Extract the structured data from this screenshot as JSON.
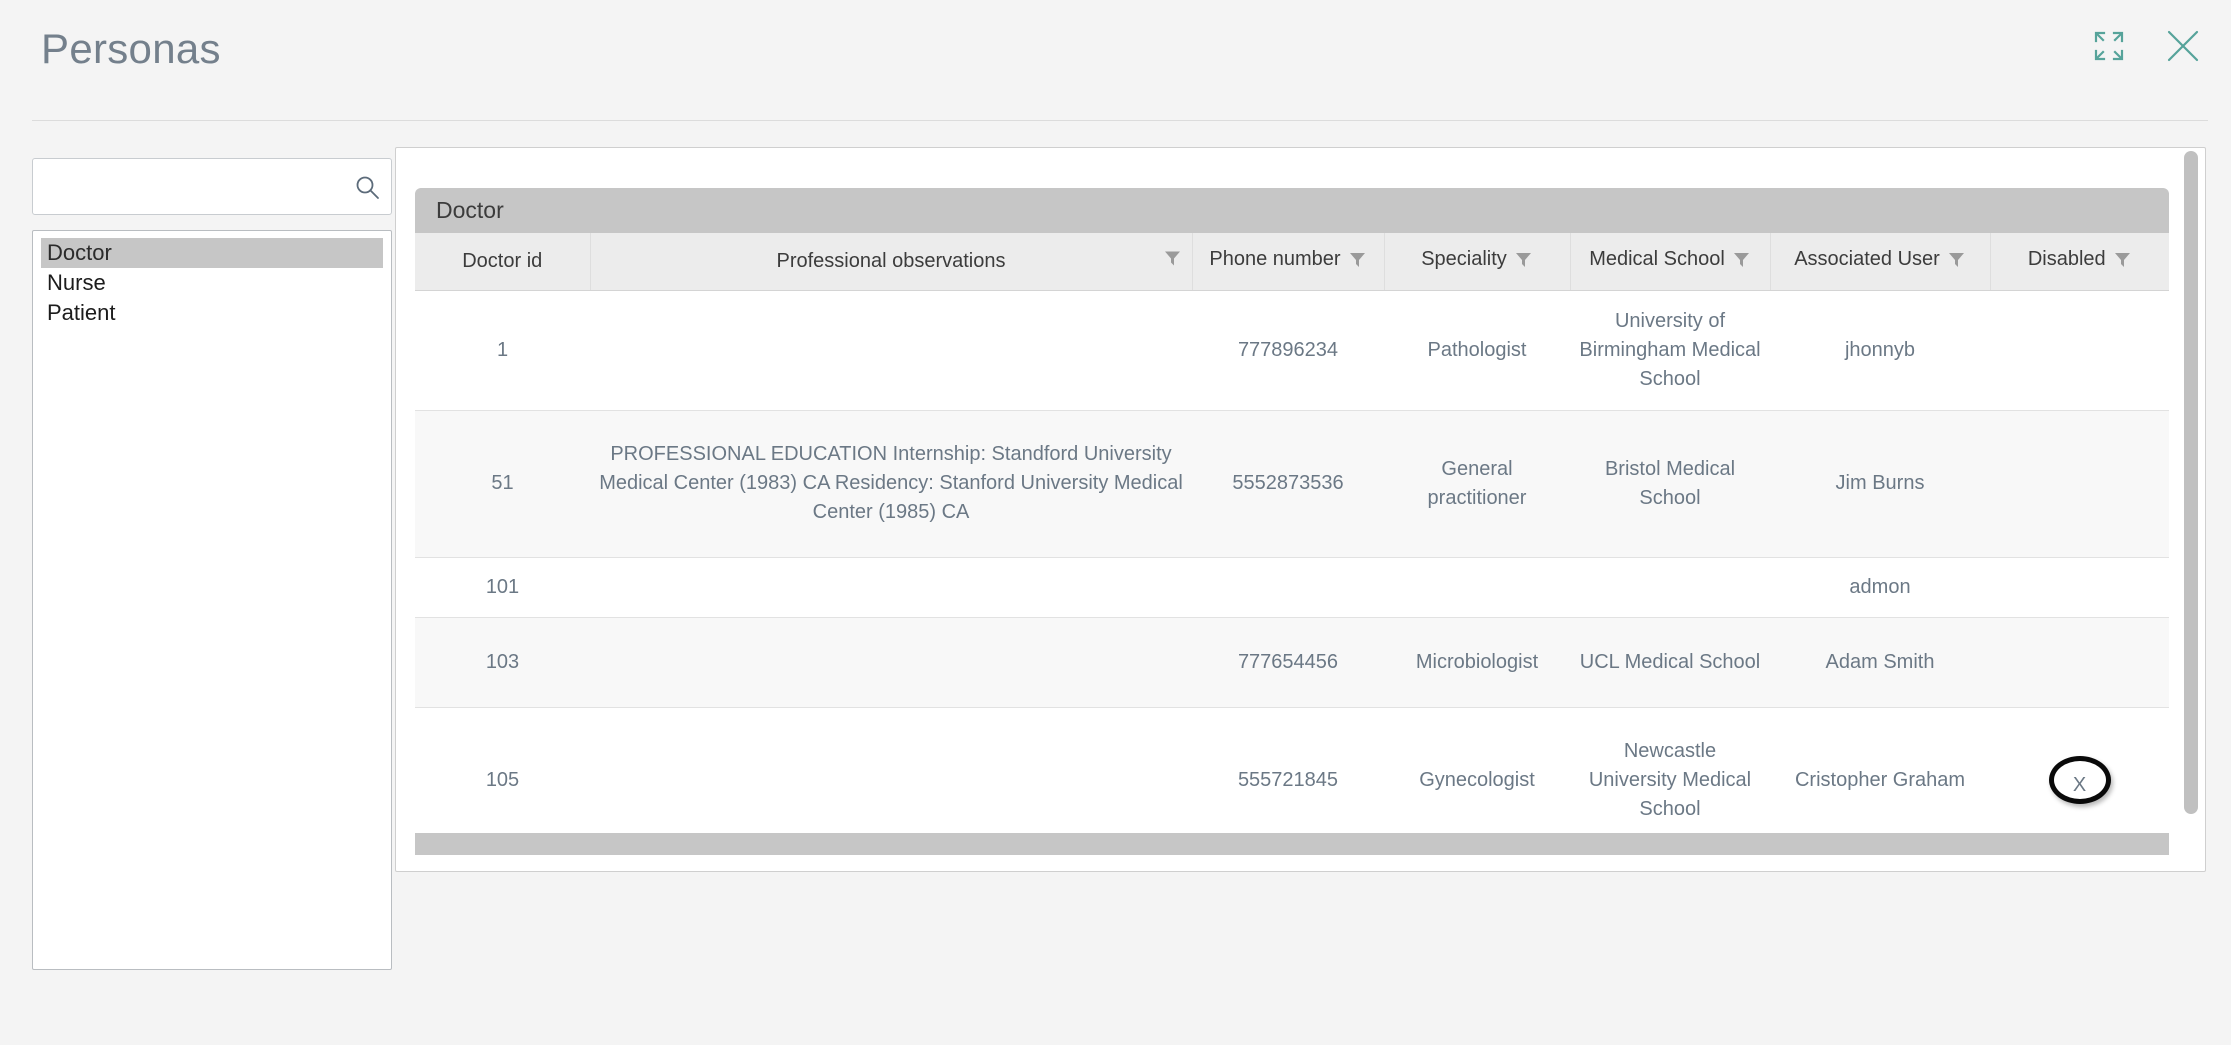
{
  "header": {
    "title": "Personas",
    "icons": [
      {
        "name": "expand-icon",
        "glyph": "expand"
      },
      {
        "name": "close-icon",
        "glyph": "close"
      }
    ],
    "accent_color": "#56a39a",
    "title_color": "#74808c"
  },
  "search": {
    "value": "",
    "placeholder": "",
    "icon": "search-icon"
  },
  "persona_list": {
    "items": [
      {
        "label": "Doctor",
        "selected": true
      },
      {
        "label": "Nurse",
        "selected": false
      },
      {
        "label": "Patient",
        "selected": false
      }
    ],
    "selected_background": "#c6c6c6"
  },
  "table": {
    "group_title": "Doctor",
    "group_header_background": "#c6c6c6",
    "filter_icon": "filter-funnel-icon",
    "columns": [
      {
        "key": "doctor_id",
        "label": "Doctor id",
        "filter": false
      },
      {
        "key": "professional_observations",
        "label": "Professional observations",
        "filter": true
      },
      {
        "key": "phone_number",
        "label": "Phone number",
        "filter": true
      },
      {
        "key": "speciality",
        "label": "Speciality",
        "filter": true
      },
      {
        "key": "medical_school",
        "label": "Medical School",
        "filter": true
      },
      {
        "key": "associated_user",
        "label": "Associated User",
        "filter": true
      },
      {
        "key": "disabled",
        "label": "Disabled",
        "filter": true
      }
    ],
    "rows": [
      {
        "doctor_id": "1",
        "professional_observations": "",
        "phone_number": "777896234",
        "speciality": "Pathologist",
        "medical_school": "University of Birmingham Medical School",
        "associated_user": "jhonnyb",
        "disabled": ""
      },
      {
        "doctor_id": "51",
        "professional_observations": "PROFESSIONAL EDUCATION Internship: Standford University Medical Center (1983) CA Residency: Stanford University Medical Center (1985) CA",
        "phone_number": "5552873536",
        "speciality": "General practitioner",
        "medical_school": "Bristol Medical School",
        "associated_user": "Jim Burns",
        "disabled": ""
      },
      {
        "doctor_id": "101",
        "professional_observations": "",
        "phone_number": "",
        "speciality": "",
        "medical_school": "",
        "associated_user": "admon",
        "disabled": ""
      },
      {
        "doctor_id": "103",
        "professional_observations": "",
        "phone_number": "777654456",
        "speciality": "Microbiologist",
        "medical_school": "UCL Medical School",
        "associated_user": "Adam Smith",
        "disabled": ""
      },
      {
        "doctor_id": "105",
        "professional_observations": "",
        "phone_number": "555721845",
        "speciality": "Gynecologist",
        "medical_school": "Newcastle University Medical School",
        "associated_user": "Cristopher Graham",
        "disabled": "X",
        "disabled_annotated": true
      }
    ]
  }
}
